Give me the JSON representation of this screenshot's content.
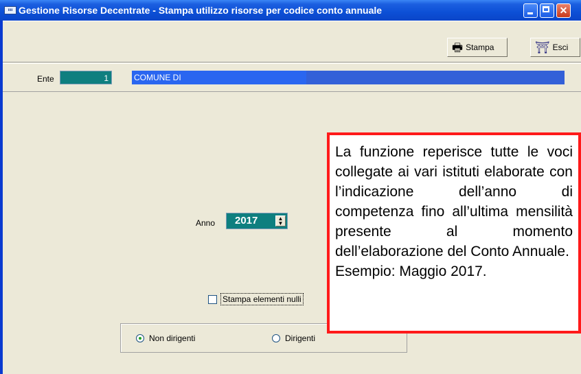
{
  "window": {
    "title": "Gestione Risorse Decentrate - Stampa utilizzo risorse per codice conto annuale",
    "icon_text": "ιιιι",
    "controls": [
      "minimize",
      "maximize",
      "close"
    ]
  },
  "toolbar": {
    "print_label": "Stampa",
    "exit_label": "Esci"
  },
  "ente": {
    "label": "Ente",
    "code": "1",
    "name": "COMUNE DI"
  },
  "form": {
    "anno_label": "Anno",
    "anno_value": "2017",
    "print_null_label": "Stampa elementi nulli",
    "print_null_checked": false,
    "radio_options": [
      {
        "label": "Non dirigenti",
        "selected": true
      },
      {
        "label": "Dirigenti",
        "selected": false
      }
    ]
  },
  "callout": {
    "text": "La funzione reperisce tutte le voci collegate ai vari istituti elaborate con l’indicazione dell’anno di competenza fino all’ultima mensilità presente al momento dell’elaborazione del Conto Annuale.",
    "example": "Esempio: Maggio 2017.",
    "border_color": "#ff1a1a"
  },
  "colors": {
    "titlebar": "#0c4fd6",
    "field_teal": "#0e7f7f",
    "selection_blue": "#3360d8"
  }
}
